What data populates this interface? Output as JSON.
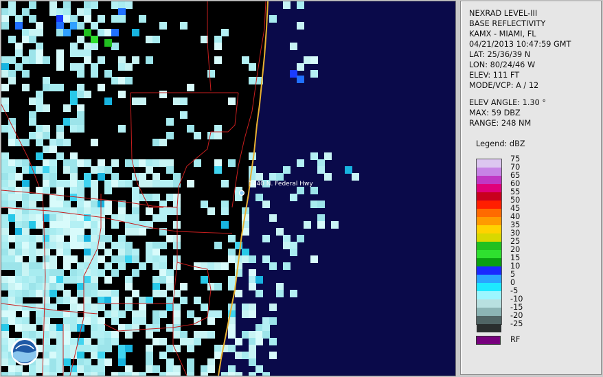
{
  "info": {
    "product": "NEXRAD LEVEL-III",
    "type": "BASE REFLECTIVITY",
    "station": "KAMX - MIAMI, FL",
    "datetime": "04/21/2013 10:47:59 GMT",
    "lat": "LAT: 25/36/39 N",
    "lon": "LON: 80/24/46 W",
    "elev": "ELEV: 111 FT",
    "mode": "MODE/VCP: A / 12",
    "elev_angle": "ELEV ANGLE: 1.30 °",
    "max": "MAX: 59 DBZ",
    "range": "RANGE: 248 NM"
  },
  "legend": {
    "title": "Legend: dBZ",
    "levels": [
      "75",
      "70",
      "65",
      "60",
      "55",
      "50",
      "45",
      "40",
      "35",
      "30",
      "25",
      "20",
      "15",
      "10",
      "5",
      "0",
      "-5",
      "-10",
      "-15",
      "-20",
      "-25"
    ],
    "colors": [
      "#dcc6f0",
      "#c783e6",
      "#c037c4",
      "#e0007a",
      "#c8001e",
      "#ff1e00",
      "#ff6a00",
      "#ff9a00",
      "#ffd200",
      "#d8d800",
      "#20c020",
      "#2fe02f",
      "#0aa010",
      "#1a28ff",
      "#2aa4ff",
      "#1ee8ff",
      "#9cf6ff",
      "#b8e0e0",
      "#8cb4b4",
      "#506464",
      "#2a2e2e"
    ],
    "rf_label": "RF",
    "rf_color": "#77007d"
  },
  "map": {
    "marker_label": "1440 N. Federal Hwy",
    "land_color": "#000000",
    "ocean_color": "#0a0a4a",
    "coast_color": "#e8b030",
    "road_color": "#c81e1e",
    "logo": "noaa-logo"
  }
}
